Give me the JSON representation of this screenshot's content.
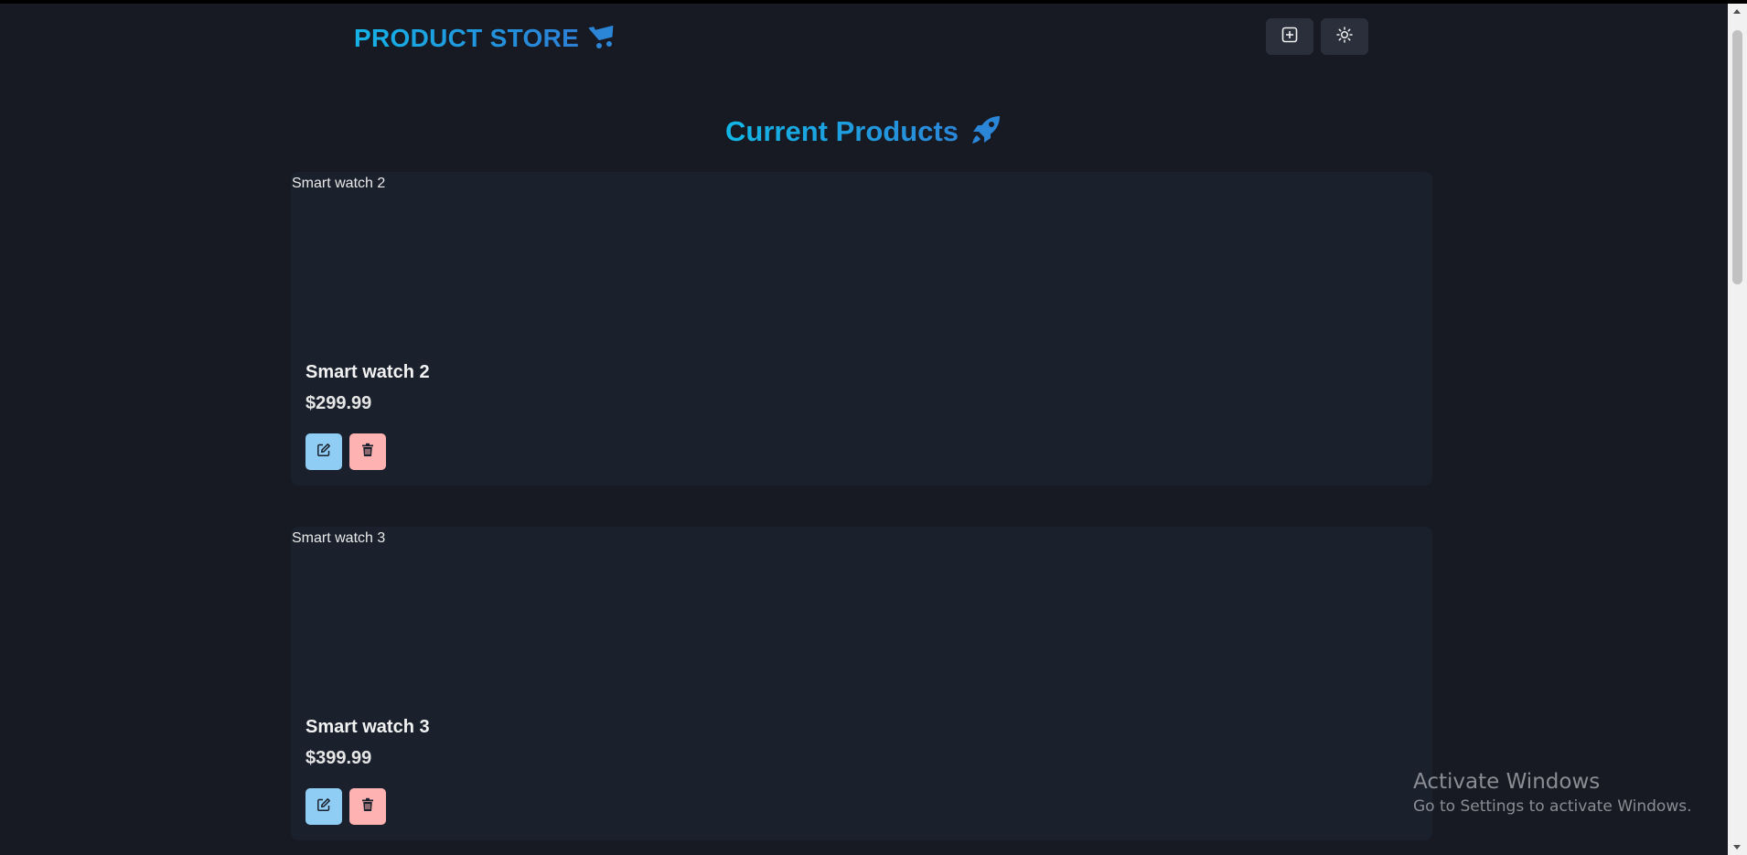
{
  "navbar": {
    "brand": "PRODUCT STORE",
    "brand_icon": "shopping-cart-icon",
    "create_button_icon": "plus-square-icon",
    "theme_button_icon": "sun-icon"
  },
  "main": {
    "heading": "Current Products",
    "heading_icon": "rocket-icon",
    "products": [
      {
        "image_alt": "Smart watch 2",
        "name": "Smart watch 2",
        "price": "$299.99",
        "edit_icon": "edit-icon",
        "delete_icon": "trash-icon"
      },
      {
        "image_alt": "Smart watch 3",
        "name": "Smart watch 3",
        "price": "$399.99",
        "edit_icon": "edit-icon",
        "delete_icon": "trash-icon"
      }
    ]
  },
  "watermark": {
    "title": "Activate Windows",
    "subtitle": "Go to Settings to activate Windows."
  },
  "colors": {
    "background": "#171923",
    "card": "#1a202c",
    "accent": "#1aa6e0",
    "edit_button": "#90cdf4",
    "delete_button": "#feb2b2"
  }
}
